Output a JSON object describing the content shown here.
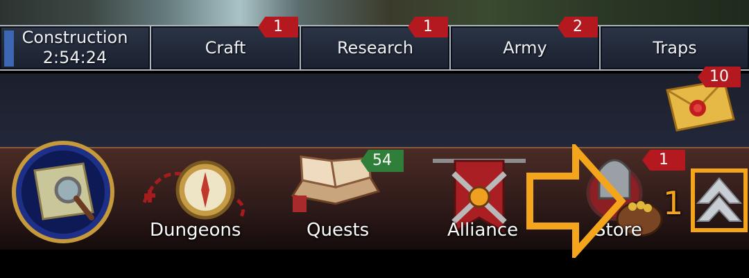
{
  "tabs": [
    {
      "label": "Construction",
      "sub": "2:54:24"
    },
    {
      "label": "Craft",
      "badge": "1"
    },
    {
      "label": "Research",
      "badge": "1"
    },
    {
      "label": "Army",
      "badge": "2"
    },
    {
      "label": "Traps"
    }
  ],
  "mail": {
    "badge": "10"
  },
  "bottom_nav": {
    "dungeons": {
      "label": "Dungeons"
    },
    "quests": {
      "label": "Quests",
      "badge": "54"
    },
    "alliance": {
      "label": "Alliance"
    },
    "store": {
      "label": "Store",
      "badge": "1"
    }
  },
  "overlay": {
    "step_number": "1",
    "accent": "#f5a51b"
  }
}
